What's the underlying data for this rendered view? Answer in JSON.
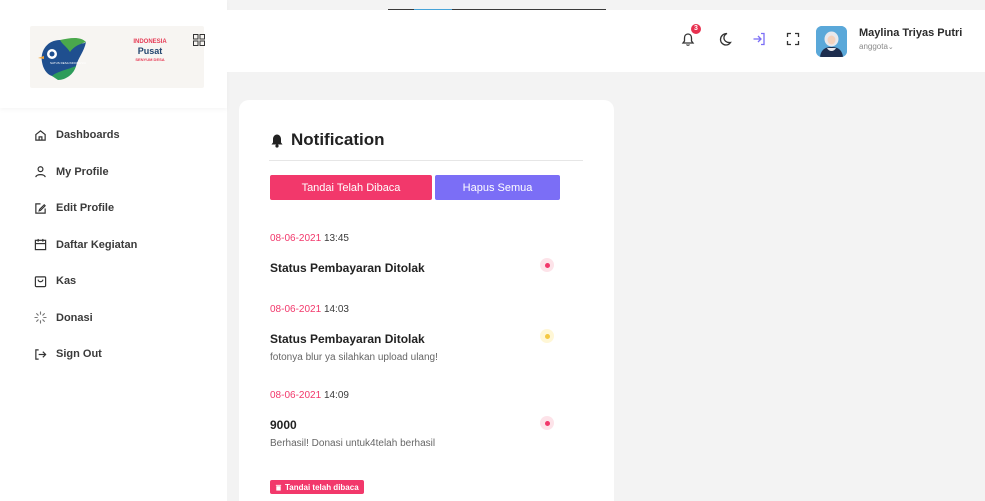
{
  "logo": {
    "line1": "INDONESIA",
    "line2": "Pusat",
    "line3": "SENYUM DESA",
    "bird_text": "SATUS DESA INDONESIA"
  },
  "sidebar": {
    "items": [
      {
        "label": "Dashboards",
        "icon": "home-icon"
      },
      {
        "label": "My Profile",
        "icon": "user-icon"
      },
      {
        "label": "Edit Profile",
        "icon": "edit-icon"
      },
      {
        "label": "Daftar Kegiatan",
        "icon": "calendar-icon"
      },
      {
        "label": "Kas",
        "icon": "shopping-bag-icon"
      },
      {
        "label": "Donasi",
        "icon": "loader-icon"
      },
      {
        "label": "Sign Out",
        "icon": "sign-out-icon"
      }
    ]
  },
  "topbar": {
    "notification_count": "3",
    "user_name": "Maylina Triyas Putri",
    "user_role": "anggota"
  },
  "notifications": {
    "title": "Notification",
    "mark_read_label": "Tandai Telah Dibaca",
    "delete_all_label": "Hapus Semua",
    "items": [
      {
        "date": "08-06-2021",
        "time": "13:45",
        "title": "Status Pembayaran Ditolak",
        "body": "",
        "status": "red"
      },
      {
        "date": "08-06-2021",
        "time": "14:03",
        "title": "Status Pembayaran Ditolak",
        "body": "fotonya blur ya silahkan upload ulang!",
        "status": "yellow"
      },
      {
        "date": "08-06-2021",
        "time": "14:09",
        "title": "9000",
        "body": "Berhasil! Donasi untuk4telah berhasil",
        "status": "red"
      }
    ],
    "small_mark_read_label": "Tandai telah dibaca"
  },
  "colors": {
    "primary_pink": "#f2386b",
    "primary_purple": "#7b6ef6",
    "status_red": "#f2386b",
    "status_yellow": "#f4c842"
  }
}
